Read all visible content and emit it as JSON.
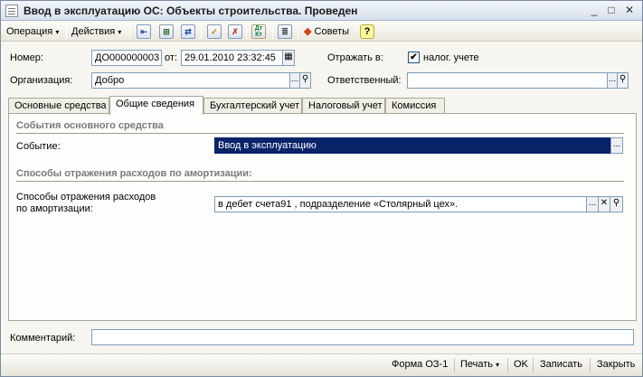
{
  "window": {
    "title": "Ввод в эксплуатацию ОС: Объекты строительства. Проведен",
    "minimize": "_",
    "maximize": "□",
    "close": "✕"
  },
  "toolbar": {
    "operation_label": "Операция",
    "actions_label": "Действия",
    "dropdown_arrow": "▾",
    "dtkt_label": "Дт Кт",
    "tips_label": "Советы",
    "help_label": "?"
  },
  "header": {
    "number_label": "Номер:",
    "number_value": "ДО000000003",
    "from_label": "от:",
    "date_value": "29.01.2010 23:32:45",
    "reflect_label": "Отражать в:",
    "tax_label": "налог. учете",
    "tax_checked": "✔",
    "org_label": "Организация:",
    "org_value": "Добро",
    "responsible_label": "Ответственный:",
    "responsible_value": ""
  },
  "tabs": [
    {
      "label": "Основные средства"
    },
    {
      "label": "Общие сведения"
    },
    {
      "label": "Бухгалтерский учет"
    },
    {
      "label": "Налоговый учет"
    },
    {
      "label": "Комиссия"
    }
  ],
  "general": {
    "events_section": "События основного средства",
    "event_label": "Событие:",
    "event_value": "Ввод в эксплуатацию",
    "amort_section": "Способы отражения расходов по амортизации:",
    "amort_label_1": "Способы отражения расходов",
    "amort_label_2": "по амортизации:",
    "amort_value": "в дебет счета91 , подразделение «Столярный цех»."
  },
  "comment": {
    "label": "Комментарий:",
    "value": ""
  },
  "footer": {
    "form_label": "Форма ОЗ-1",
    "print_label": "Печать",
    "ok_label": "OK",
    "save_label": "Записать",
    "close_label": "Закрыть"
  },
  "glyphs": {
    "ellipsis": "...",
    "clear": "✕",
    "search": "🔍"
  }
}
